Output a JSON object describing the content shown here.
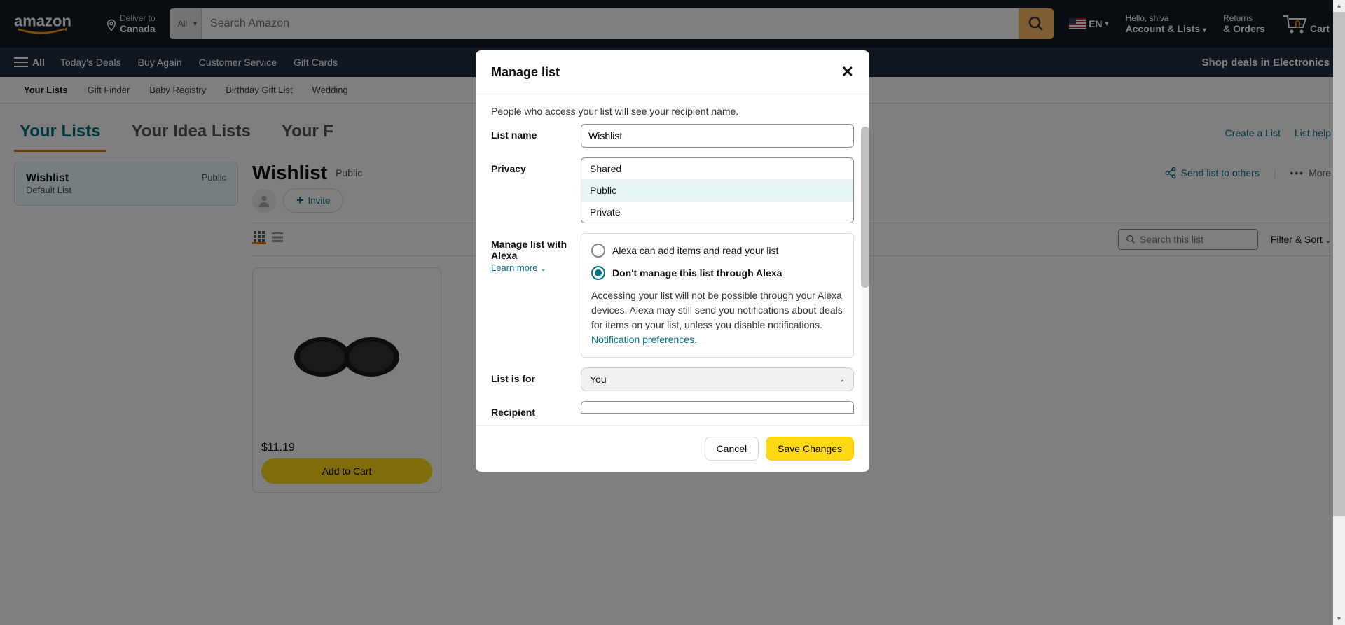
{
  "nav": {
    "deliver_to": "Deliver to",
    "country": "Canada",
    "search_category": "All",
    "search_placeholder": "Search Amazon",
    "lang": "EN",
    "hello": "Hello, shiva",
    "account": "Account & Lists",
    "returns": "Returns",
    "orders": "& Orders",
    "cart_count": "0",
    "cart_label": "Cart"
  },
  "subnav": {
    "all": "All",
    "links": [
      "Today's Deals",
      "Buy Again",
      "Customer Service",
      "Gift Cards"
    ],
    "promo": "Shop deals in Electronics"
  },
  "tertiary": {
    "links": [
      "Your Lists",
      "Gift Finder",
      "Baby Registry",
      "Birthday Gift List",
      "Wedding"
    ]
  },
  "tabs": {
    "items": [
      "Your Lists",
      "Your Idea Lists",
      "Your F"
    ],
    "create": "Create a List",
    "help": "List help"
  },
  "sidebar": {
    "list_name": "Wishlist",
    "list_sub": "Default List",
    "list_priv": "Public"
  },
  "detail": {
    "title": "Wishlist",
    "privacy": "Public",
    "invite": "Invite",
    "send": "Send list to others",
    "more": "More",
    "search_placeholder": "Search this list",
    "filter": "Filter & Sort"
  },
  "product": {
    "price": "$11.19",
    "add": "Add to Cart"
  },
  "modal": {
    "title": "Manage list",
    "subtitle": "People who access your list will see your recipient name.",
    "list_name_label": "List name",
    "list_name_value": "Wishlist",
    "privacy_label": "Privacy",
    "privacy_options": [
      "Shared",
      "Public",
      "Private"
    ],
    "alexa_label": "Manage list with Alexa",
    "learn_more": "Learn more",
    "alexa_opt1": "Alexa can add items and read your list",
    "alexa_opt2": "Don't manage this list through Alexa",
    "alexa_desc1": "Accessing your list will not be possible through your Alexa devices. Alexa may still send you notifications about deals for items on your list, unless you disable notifications. ",
    "alexa_link": "Notification preferences.",
    "list_for_label": "List is for",
    "list_for_value": "You",
    "recipient_label": "Recipient",
    "cancel": "Cancel",
    "save": "Save Changes"
  }
}
